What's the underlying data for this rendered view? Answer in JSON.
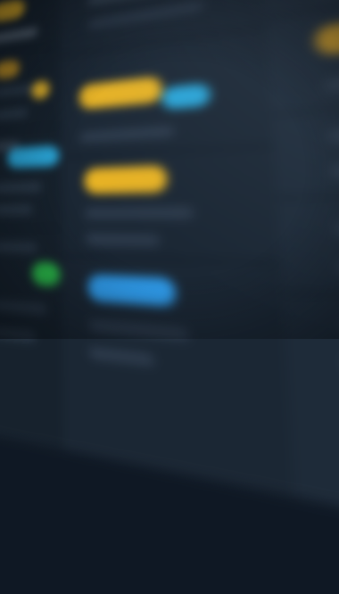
{
  "colors": {
    "background": "#0f1824",
    "panel": "#1b2734",
    "accent_yellow": "#e8b324",
    "accent_blue": "#2f9bea",
    "accent_cyan": "#2aa6d8",
    "accent_deep_blue": "#2456d6",
    "accent_green": "#2bbf4a"
  },
  "sidebar": {
    "items": [
      {
        "badge": "yellow"
      },
      {
        "badge": "orange"
      },
      {
        "badge": "cyan"
      },
      {
        "badge": "green"
      }
    ]
  },
  "main": {
    "tags": [
      "yellow",
      "cyan",
      "yellow",
      "blue"
    ]
  },
  "detail": {
    "tags": [
      "yellow",
      "deep-blue"
    ]
  }
}
